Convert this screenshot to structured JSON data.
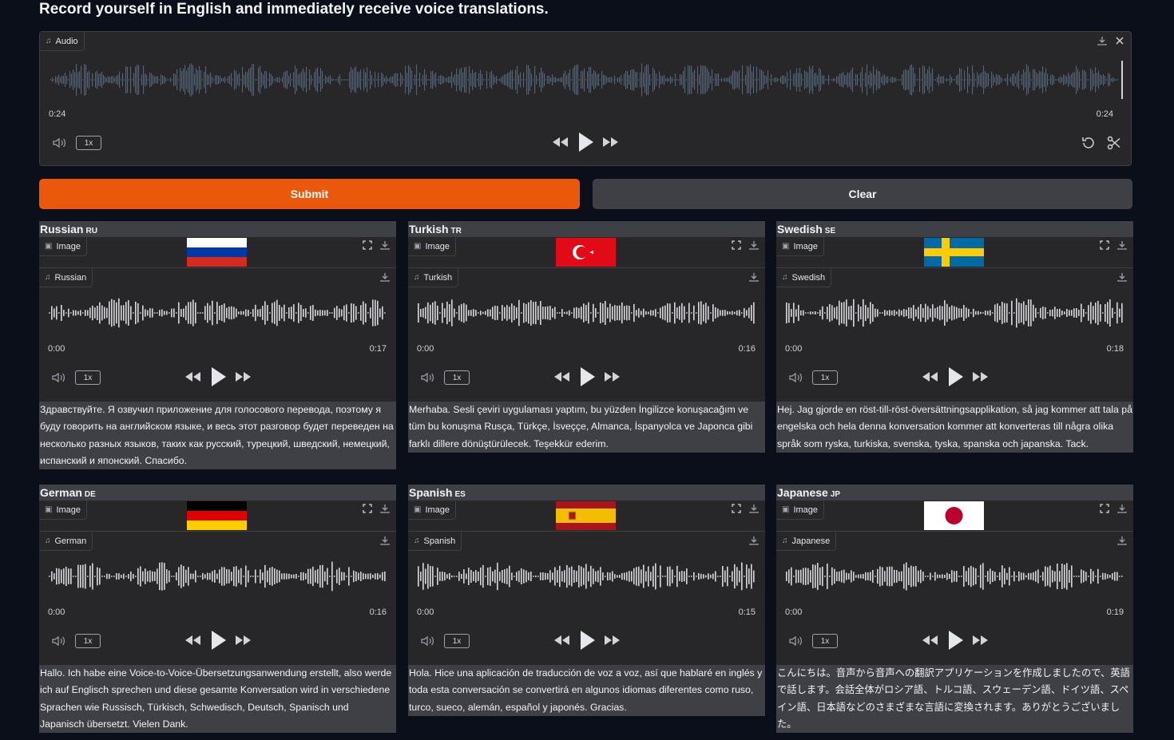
{
  "headline": "Record yourself in English and immediately receive voice translations.",
  "input_audio": {
    "label": "Audio",
    "time_current": "0:24",
    "time_total": "0:24",
    "speed": "1x",
    "wave_color": "#1d74c5"
  },
  "buttons": {
    "submit": "Submit",
    "clear": "Clear"
  },
  "colors": {
    "submit": "#ea580c",
    "clear": "#3f3f46",
    "card_bg": "#27272a",
    "title_bg": "#3f3f46"
  },
  "image_label": "Image",
  "cards": [
    {
      "title": "Russian",
      "code": "RU",
      "audio_label": "Russian",
      "time_start": "0:00",
      "time_end": "0:17",
      "speed": "1x",
      "text": "Здравствуйте. Я озвучил приложение для голосового перевода, поэтому я буду говорить на английском языке, и весь этот разговор будет переведен на несколько разных языков, таких как русский, турецкий, шведский, немецкий, испанский и японский. Спасибо."
    },
    {
      "title": "Turkish",
      "code": "TR",
      "audio_label": "Turkish",
      "time_start": "0:00",
      "time_end": "0:16",
      "speed": "1x",
      "text": "Merhaba. Sesli çeviri uygulaması yaptım, bu yüzden İngilizce konuşacağım ve tüm bu konuşma Rusça, Türkçe, İsveççe, Almanca, İspanyolca ve Japonca gibi farklı dillere dönüştürülecek. Teşekkür ederim."
    },
    {
      "title": "Swedish",
      "code": "SE",
      "audio_label": "Swedish",
      "time_start": "0:00",
      "time_end": "0:18",
      "speed": "1x",
      "text": "Hej. Jag gjorde en röst-till-röst-översättningsapplikation, så jag kommer att tala på engelska och hela denna konversation kommer att konverteras till några olika språk som ryska, turkiska, svenska, tyska, spanska och japanska. Tack."
    },
    {
      "title": "German",
      "code": "DE",
      "audio_label": "German",
      "time_start": "0:00",
      "time_end": "0:16",
      "speed": "1x",
      "text": "Hallo. Ich habe eine Voice-to-Voice-Übersetzungsanwendung erstellt, also werde ich auf Englisch sprechen und diese gesamte Konversation wird in verschiedene Sprachen wie Russisch, Türkisch, Schwedisch, Deutsch, Spanisch und Japanisch übersetzt. Vielen Dank."
    },
    {
      "title": "Spanish",
      "code": "ES",
      "audio_label": "Spanish",
      "time_start": "0:00",
      "time_end": "0:15",
      "speed": "1x",
      "text": "Hola. Hice una aplicación de traducción de voz a voz, así que hablaré en inglés y toda esta conversación se convertirá en algunos idiomas diferentes como ruso, turco, sueco, alemán, español y japonés. Gracias."
    },
    {
      "title": "Japanese",
      "code": "JP",
      "audio_label": "Japanese",
      "time_start": "0:00",
      "time_end": "0:19",
      "speed": "1x",
      "text": "こんにちは。音声から音声への翻訳アプリケーションを作成しましたので、英語で話します。会話全体がロシア語、トルコ語、スウェーデン語、ドイツ語、スペイン語、日本語などのさまざまな言語に変換されます。ありがとうございました。"
    }
  ]
}
